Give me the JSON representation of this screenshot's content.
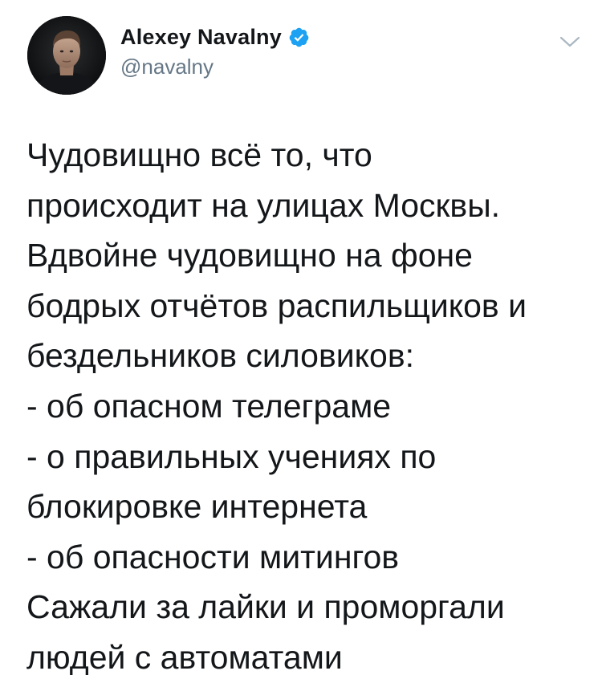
{
  "author": {
    "display_name": "Alexey Navalny",
    "handle": "@navalny",
    "verified": true
  },
  "icons": {
    "verified": "verified-badge-icon",
    "menu": "chevron-down-icon"
  },
  "colors": {
    "verified_blue": "#1da1f2",
    "handle_gray": "#657786",
    "text": "#14171a",
    "chevron_gray": "#aab8c2"
  },
  "tweet": {
    "lines": [
      "Чудовищно всё то, что",
      "происходит на улицах Москвы.",
      "Вдвойне чудовищно на фоне",
      "бодрых отчётов распильщиков и",
      "бездельников силовиков:",
      "- об опасном телеграме",
      "- о правильных учениях по",
      "блокировке интернета",
      "- об опасности митингов",
      "Сажали за лайки и проморгали",
      "людей с автоматами"
    ]
  }
}
